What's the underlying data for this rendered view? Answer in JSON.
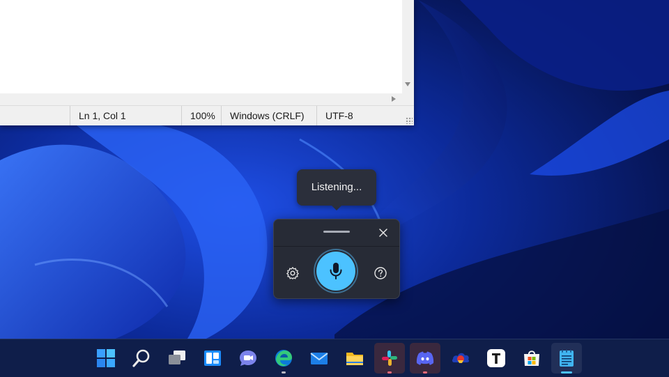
{
  "notepad": {
    "status": {
      "position": "Ln 1, Col 1",
      "zoom": "100%",
      "line_ending": "Windows (CRLF)",
      "encoding": "UTF-8"
    }
  },
  "voice_typing": {
    "tooltip": "Listening...",
    "state": "listening"
  },
  "taskbar": {
    "items": [
      {
        "name": "start",
        "icon": "windows-logo-icon"
      },
      {
        "name": "search",
        "icon": "search-icon"
      },
      {
        "name": "task-view",
        "icon": "task-view-icon"
      },
      {
        "name": "widgets",
        "icon": "widgets-icon"
      },
      {
        "name": "chat",
        "icon": "teams-chat-icon"
      },
      {
        "name": "edge",
        "icon": "edge-icon"
      },
      {
        "name": "mail",
        "icon": "mail-icon"
      },
      {
        "name": "file-explorer",
        "icon": "folder-icon"
      },
      {
        "name": "slack",
        "icon": "slack-icon"
      },
      {
        "name": "discord",
        "icon": "discord-icon"
      },
      {
        "name": "app",
        "icon": "cloud-app-icon"
      },
      {
        "name": "typora",
        "icon": "typora-icon"
      },
      {
        "name": "store",
        "icon": "store-icon"
      },
      {
        "name": "notepad",
        "icon": "notepad-icon"
      }
    ]
  },
  "colors": {
    "accent": "#4cc2ff",
    "flyout_bg": "#272b36",
    "taskbar_bg": "#0f1e4a"
  }
}
